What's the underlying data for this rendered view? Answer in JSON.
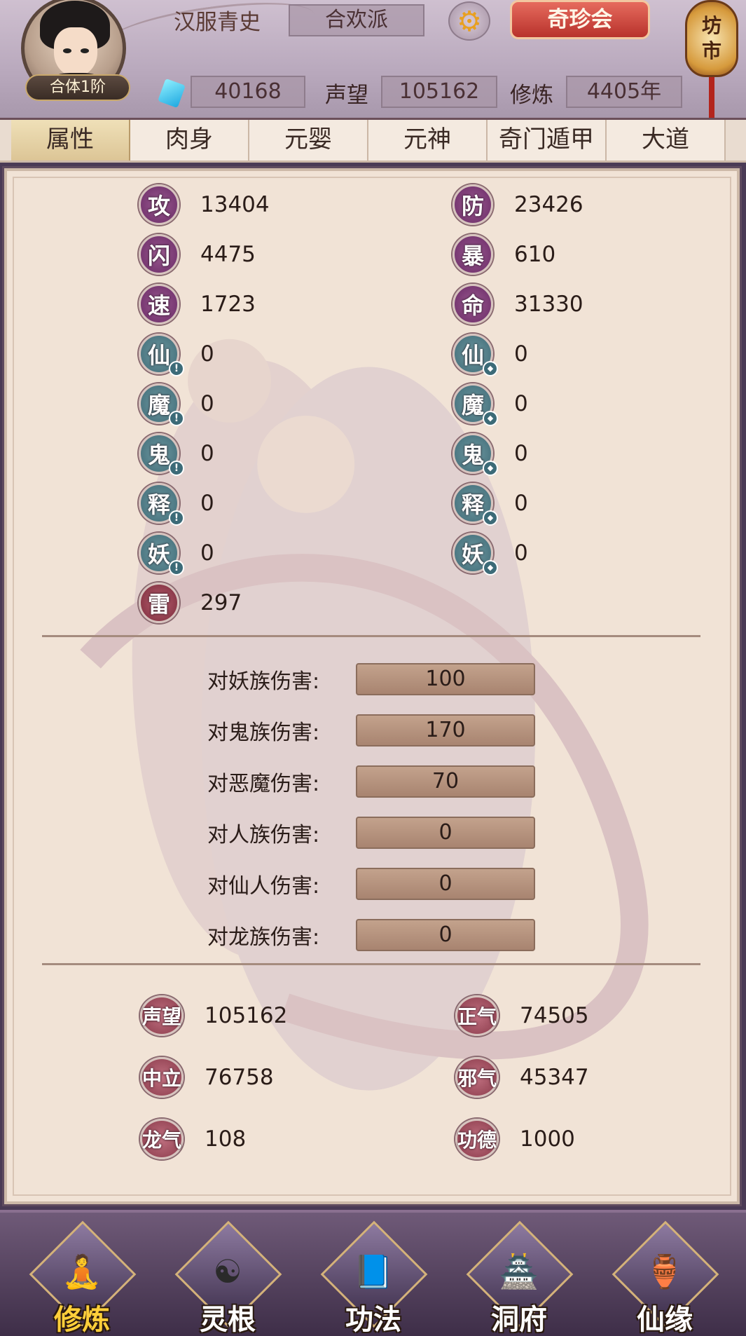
{
  "header": {
    "rank": "合体1阶",
    "name": "汉服青史",
    "sect": "合欢派",
    "gear_icon": "gear-icon",
    "treasure_button": "奇珍会",
    "market_label": "坊市",
    "spirit_stones": "40168",
    "reputation_label": "声望",
    "reputation_value": "105162",
    "cultivation_label": "修炼",
    "cultivation_value": "4405年"
  },
  "tabs": [
    {
      "label": "属性",
      "active": true
    },
    {
      "label": "肉身",
      "active": false
    },
    {
      "label": "元婴",
      "active": false
    },
    {
      "label": "元神",
      "active": false
    },
    {
      "label": "奇门遁甲",
      "active": false
    },
    {
      "label": "大道",
      "active": false
    }
  ],
  "stats_left": [
    {
      "icon": "攻",
      "value": "13404",
      "color": "purple"
    },
    {
      "icon": "闪",
      "value": "4475",
      "color": "purple"
    },
    {
      "icon": "速",
      "value": "1723",
      "color": "purple"
    },
    {
      "icon": "仙",
      "value": "0",
      "color": "teal",
      "badge": "!"
    },
    {
      "icon": "魔",
      "value": "0",
      "color": "teal",
      "badge": "!"
    },
    {
      "icon": "鬼",
      "value": "0",
      "color": "teal",
      "badge": "!"
    },
    {
      "icon": "释",
      "value": "0",
      "color": "teal",
      "badge": "!"
    },
    {
      "icon": "妖",
      "value": "0",
      "color": "teal",
      "badge": "!"
    },
    {
      "icon": "雷",
      "value": "297",
      "color": "red"
    }
  ],
  "stats_right": [
    {
      "icon": "防",
      "value": "23426",
      "color": "purple"
    },
    {
      "icon": "暴",
      "value": "610",
      "color": "purple"
    },
    {
      "icon": "命",
      "value": "31330",
      "color": "purple"
    },
    {
      "icon": "仙",
      "value": "0",
      "color": "teal",
      "badge": "shield"
    },
    {
      "icon": "魔",
      "value": "0",
      "color": "teal",
      "badge": "shield"
    },
    {
      "icon": "鬼",
      "value": "0",
      "color": "teal",
      "badge": "shield"
    },
    {
      "icon": "释",
      "value": "0",
      "color": "teal",
      "badge": "shield"
    },
    {
      "icon": "妖",
      "value": "0",
      "color": "teal",
      "badge": "shield"
    }
  ],
  "damage_bonus": [
    {
      "label": "对妖族伤害:",
      "value": "100"
    },
    {
      "label": "对鬼族伤害:",
      "value": "170"
    },
    {
      "label": "对恶魔伤害:",
      "value": "70"
    },
    {
      "label": "对人族伤害:",
      "value": "0"
    },
    {
      "label": "对仙人伤害:",
      "value": "0"
    },
    {
      "label": "对龙族伤害:",
      "value": "0"
    }
  ],
  "extra_left": [
    {
      "icon": "声望",
      "value": "105162"
    },
    {
      "icon": "中立",
      "value": "76758"
    },
    {
      "icon": "龙气",
      "value": "108"
    }
  ],
  "extra_right": [
    {
      "icon": "正气",
      "value": "74505"
    },
    {
      "icon": "邪气",
      "value": "45347"
    },
    {
      "icon": "功德",
      "value": "1000"
    }
  ],
  "nav": [
    {
      "label": "修炼",
      "active": true,
      "icon": "meditating-figure-icon"
    },
    {
      "label": "灵根",
      "active": false,
      "icon": "yin-yang-sword-icon"
    },
    {
      "label": "功法",
      "active": false,
      "icon": "book-icon"
    },
    {
      "label": "洞府",
      "active": false,
      "icon": "pagoda-icon"
    },
    {
      "label": "仙缘",
      "active": false,
      "icon": "gourd-icon"
    }
  ],
  "colors": {
    "purple": "#6a2a66",
    "teal": "#3f6a76",
    "red": "#7a2a3a",
    "active_nav": "#ffcf3a"
  }
}
